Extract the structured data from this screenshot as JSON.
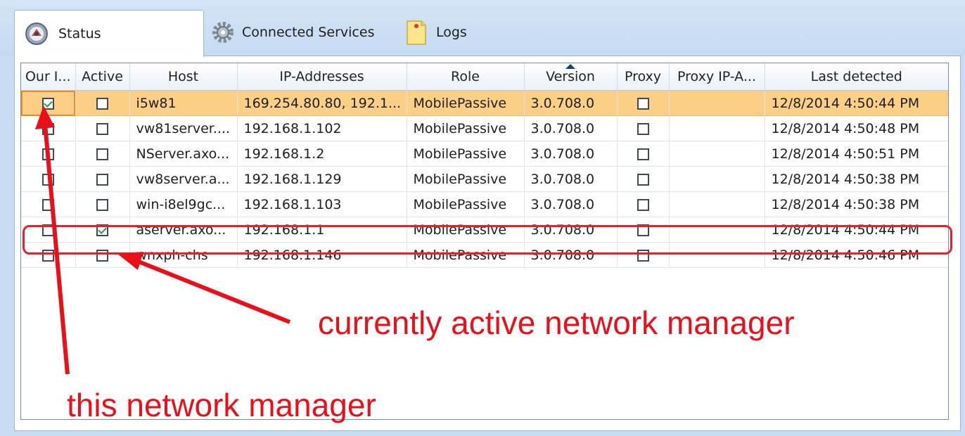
{
  "tabs": [
    {
      "label": "Status",
      "icon": "status-icon",
      "active": true
    },
    {
      "label": "Connected Services",
      "icon": "gear-icon",
      "active": false
    },
    {
      "label": "Logs",
      "icon": "note-icon",
      "active": false
    }
  ],
  "columns": [
    "Our I...",
    "Active",
    "Host",
    "IP-Addresses",
    "Role",
    "Version",
    "Proxy",
    "Proxy IP-A...",
    "Last detected"
  ],
  "sort_column": "Version",
  "rows": [
    {
      "our": true,
      "active": false,
      "host": "i5w81",
      "ip": "169.254.80.80, 192.1...",
      "role": "MobilePassive",
      "version": "3.0.708.0",
      "proxy": false,
      "proxy_ip": "",
      "last": "12/8/2014 4:50:44 PM",
      "selected": true
    },
    {
      "our": false,
      "active": false,
      "host": "vw81server....",
      "ip": "192.168.1.102",
      "role": "MobilePassive",
      "version": "3.0.708.0",
      "proxy": false,
      "proxy_ip": "",
      "last": "12/8/2014 4:50:48 PM"
    },
    {
      "our": false,
      "active": false,
      "host": "NServer.axo...",
      "ip": "192.168.1.2",
      "role": "MobilePassive",
      "version": "3.0.708.0",
      "proxy": false,
      "proxy_ip": "",
      "last": "12/8/2014 4:50:51 PM"
    },
    {
      "our": false,
      "active": false,
      "host": "vw8server.a...",
      "ip": "192.168.1.129",
      "role": "MobilePassive",
      "version": "3.0.708.0",
      "proxy": false,
      "proxy_ip": "",
      "last": "12/8/2014 4:50:38 PM"
    },
    {
      "our": false,
      "active": false,
      "host": "win-i8el9gc...",
      "ip": "192.168.1.103",
      "role": "MobilePassive",
      "version": "3.0.708.0",
      "proxy": false,
      "proxy_ip": "",
      "last": "12/8/2014 4:50:38 PM"
    },
    {
      "our": false,
      "active": true,
      "host": "aserver.axo...",
      "ip": "192.168.1.1",
      "role": "MobilePassive",
      "version": "3.0.708.0",
      "proxy": false,
      "proxy_ip": "",
      "last": "12/8/2014 4:50:44 PM"
    },
    {
      "our": false,
      "active": false,
      "host": "wnxph-chs",
      "ip": "192.168.1.146",
      "role": "MobilePassive",
      "version": "3.0.708.0",
      "proxy": false,
      "proxy_ip": "",
      "last": "12/8/2014 4:50:46 PM"
    }
  ],
  "annotations": {
    "active_label": "currently active network manager",
    "this_label": "this network manager"
  },
  "colors": {
    "selected_row": "#fbcf86",
    "annotation": "#e8101a",
    "check": "#22a33a"
  }
}
